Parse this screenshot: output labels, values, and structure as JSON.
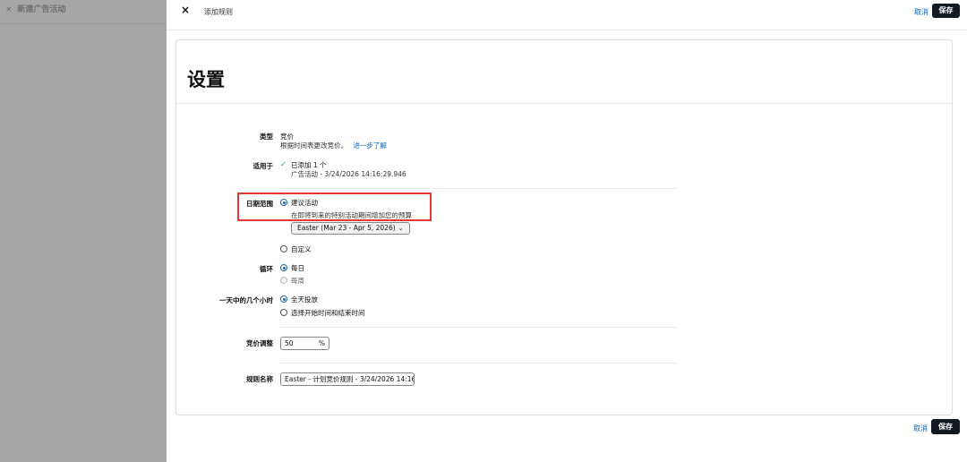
{
  "backdrop": {
    "close_icon": "×",
    "title": "新建广告活动"
  },
  "header": {
    "close_icon": "×",
    "title": "添加规则",
    "cancel_label": "取消",
    "save_label": "保存"
  },
  "section": {
    "title": "设置"
  },
  "type_row": {
    "label": "类型",
    "value": "竞价",
    "description": "根据时间表更改竞价。",
    "learn_more": "进一步了解"
  },
  "applies_row": {
    "label": "适用于",
    "check_icon": "✓",
    "added": "已添加 1 个",
    "campaign": "广告活动 - 3/24/2026 14:16:29.946"
  },
  "date_range": {
    "label": "日期范围",
    "suggested_label": "建议活动",
    "suggested_selected": true,
    "suggested_hint": "在即将到来的特别活动期间增加您的预算",
    "event_selected": "Easter (Mar 23 - Apr 5, 2026)",
    "chevron_icon": "⌄",
    "custom_label": "自定义"
  },
  "recurrence": {
    "label": "循环",
    "daily": "每日",
    "weekly": "每周",
    "selected": "daily"
  },
  "hours": {
    "label": "一天中的几个小时",
    "all_day": "全天投放",
    "select_hours": "选择开始时间和结束时间",
    "selected": "all_day"
  },
  "bid_adjustment": {
    "label": "竞价调整",
    "value": "50",
    "unit": "%"
  },
  "rule_name": {
    "label": "规则名称",
    "value": "Easter - 计划竞价规则 - 3/24/2026 14:16:3"
  },
  "footer": {
    "cancel_label": "取消",
    "save_label": "保存"
  },
  "colors": {
    "primary_button": "#131a22",
    "link": "#0066c0",
    "highlight": "#e53935",
    "radio": "#2162a1",
    "check": "#2e8b57"
  }
}
